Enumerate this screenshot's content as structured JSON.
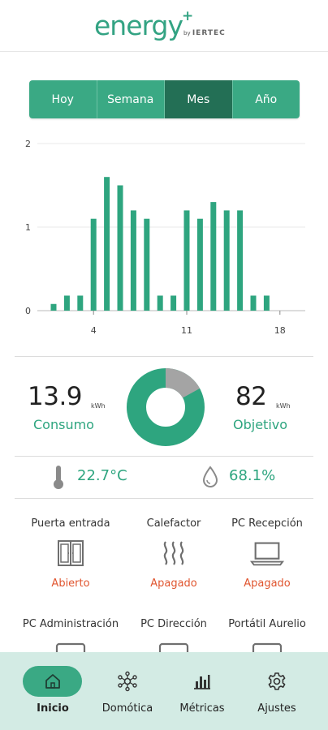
{
  "header": {
    "logo_text": "energy",
    "logo_plus": "+",
    "logo_by": "by",
    "logo_brand": "IERTEC"
  },
  "tabs": [
    {
      "label": "Hoy",
      "active": false
    },
    {
      "label": "Semana",
      "active": false
    },
    {
      "label": "Mes",
      "active": true
    },
    {
      "label": "Año",
      "active": false
    }
  ],
  "chart_data": {
    "type": "bar",
    "x": [
      1,
      2,
      3,
      4,
      5,
      6,
      7,
      8,
      9,
      10,
      11,
      12,
      13,
      14,
      15,
      16,
      17,
      18
    ],
    "values": [
      0.08,
      0.18,
      0.18,
      1.1,
      1.6,
      1.5,
      1.2,
      1.1,
      0.18,
      0.18,
      1.2,
      1.1,
      1.3,
      1.2,
      1.2,
      0.18,
      0.18,
      0
    ],
    "ylim": [
      0,
      2
    ],
    "yticks": [
      "0",
      "1",
      "2"
    ],
    "xticks": [
      "4",
      "11",
      "18"
    ],
    "xtick_values": [
      4,
      11,
      18
    ],
    "grid": true,
    "bar_color": "#2ea57f"
  },
  "consumo": {
    "value": "13.9",
    "unit": "kWh",
    "label": "Consumo"
  },
  "objetivo": {
    "value": "82",
    "unit": "kWh",
    "label": "Objetivo"
  },
  "donut": {
    "fraction_consumed": 0.17,
    "color_main": "#2ea57f",
    "color_rest": "#a4a4a4"
  },
  "environment": {
    "temperature": "22.7°C",
    "humidity": "68.1%"
  },
  "devices": [
    {
      "name": "Puerta entrada",
      "status": "Abierto",
      "icon": "door-icon"
    },
    {
      "name": "Calefactor",
      "status": "Apagado",
      "icon": "heater-icon"
    },
    {
      "name": "PC Recepción",
      "status": "Apagado",
      "icon": "laptop-icon"
    },
    {
      "name": "PC Administración",
      "status": "",
      "icon": "monitor-icon"
    },
    {
      "name": "PC Dirección",
      "status": "",
      "icon": "monitor-icon"
    },
    {
      "name": "Portátil Aurelio",
      "status": "",
      "icon": "monitor-icon"
    }
  ],
  "nav": [
    {
      "label": "Inicio",
      "icon": "home-icon",
      "active": true
    },
    {
      "label": "Domótica",
      "icon": "network-icon",
      "active": false
    },
    {
      "label": "Métricas",
      "icon": "bar-chart-icon",
      "active": false
    },
    {
      "label": "Ajustes",
      "icon": "gear-icon",
      "active": false
    }
  ]
}
